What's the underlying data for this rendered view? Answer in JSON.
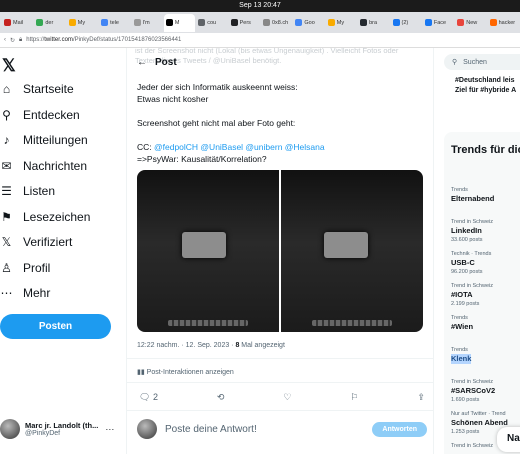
{
  "system": {
    "datetime": "Sep 13  20:47"
  },
  "tabs": [
    {
      "label": "Mail",
      "color": "#c5221f",
      "active": false
    },
    {
      "label": "der",
      "color": "#34a853",
      "active": false
    },
    {
      "label": "My",
      "color": "#f9ab00",
      "active": false
    },
    {
      "label": "tele",
      "color": "#4285f4",
      "active": false
    },
    {
      "label": "I'm",
      "color": "#999999",
      "active": false
    },
    {
      "label": "M",
      "color": "#000000",
      "active": true
    },
    {
      "label": "cou",
      "color": "#5f6368",
      "active": false
    },
    {
      "label": "Pers",
      "color": "#202124",
      "active": false
    },
    {
      "label": "0x8.ch",
      "color": "#888888",
      "active": false
    },
    {
      "label": "Goo",
      "color": "#4285f4",
      "active": false
    },
    {
      "label": "My",
      "color": "#f9ab00",
      "active": false
    },
    {
      "label": "bra",
      "color": "#24292f",
      "active": false
    },
    {
      "label": "(2)",
      "color": "#1877f2",
      "active": false
    },
    {
      "label": "Face",
      "color": "#1877f2",
      "active": false
    },
    {
      "label": "New",
      "color": "#e8453c",
      "active": false
    },
    {
      "label": "hacker",
      "color": "#ff6600",
      "active": false
    }
  ],
  "address": {
    "prefix": "https://",
    "host": "twitter.com",
    "path": "/PinkyDef/status/1701541876023566441"
  },
  "sidebar": {
    "items": [
      {
        "label": "Startseite",
        "icon": "home-icon",
        "glyph": "⌂"
      },
      {
        "label": "Entdecken",
        "icon": "search-icon",
        "glyph": "⚲"
      },
      {
        "label": "Mitteilungen",
        "icon": "bell-icon",
        "glyph": "♪"
      },
      {
        "label": "Nachrichten",
        "icon": "mail-icon",
        "glyph": "✉"
      },
      {
        "label": "Listen",
        "icon": "list-icon",
        "glyph": "☰"
      },
      {
        "label": "Lesezeichen",
        "icon": "bookmark-icon",
        "glyph": "⚑"
      },
      {
        "label": "Verifiziert",
        "icon": "x-logo-icon",
        "glyph": "𝕏"
      },
      {
        "label": "Profil",
        "icon": "person-icon",
        "glyph": "♙"
      },
      {
        "label": "Mehr",
        "icon": "more-icon",
        "glyph": "⋯"
      }
    ],
    "post_label": "Posten",
    "profile": {
      "name": "Marc jr. Landolt (th...",
      "handle": "@PinkyDef",
      "more": "···"
    }
  },
  "tweet": {
    "ghost_text": "ist der Screenshot nicht (Lokal (bis etwas Ungenauigkeit) . Vielleicht Fotos oder Texten dieses Tweets / @UniBasel benötigt.",
    "header_back": "←",
    "header_title": "Post",
    "line1": "Jeder der sich Informatik auskeennt weiss:",
    "line2": "Etwas nicht kosher",
    "line3": "Screenshot geht nicht mal aber Foto geht:",
    "cc_prefix": "CC: ",
    "mentions": "@fedpolCH @UniBasel @unibern @Helsana",
    "line5": "=>PsyWar: Kausalität/Korrelation?",
    "time": "12:22 nachm. · 12. Sep. 2023 · ",
    "views_count": "8",
    "views_label": " Mal angezeigt",
    "interactions": "Post-Interaktionen anzeigen",
    "reply_count": "2",
    "reply_placeholder": "Poste deine Antwort!",
    "reply_button": "Antworten"
  },
  "right": {
    "search_placeholder": "Suchen",
    "prev_trend_line1": "#Deutschland leis",
    "prev_trend_line2": "Ziel für #hybride A",
    "trends_title": "Trends für dic",
    "trends": [
      {
        "context": "Trends",
        "name": "Elternabend",
        "posts": ""
      },
      {
        "context": "Trend in Schweiz",
        "name": "LinkedIn",
        "posts": "33.600 posts"
      },
      {
        "context": "Technik · Trends",
        "name": "USB-C",
        "posts": "96.200 posts"
      },
      {
        "context": "Trend in Schweiz",
        "name": "#IOTA",
        "posts": "2.199 posts"
      },
      {
        "context": "Trends",
        "name": "#Wien",
        "posts": ""
      },
      {
        "context": "Trends",
        "name": "Klenk",
        "posts": ""
      },
      {
        "context": "Trend in Schweiz",
        "name": "#SARSCoV2",
        "posts": "1.690 posts"
      },
      {
        "context": "Nur auf Twitter · Trend",
        "name": "Schönen Abend",
        "posts": "1.253 posts"
      },
      {
        "context": "Trend in Schweiz",
        "name": "",
        "posts": ""
      }
    ],
    "messages_label": "Na"
  }
}
